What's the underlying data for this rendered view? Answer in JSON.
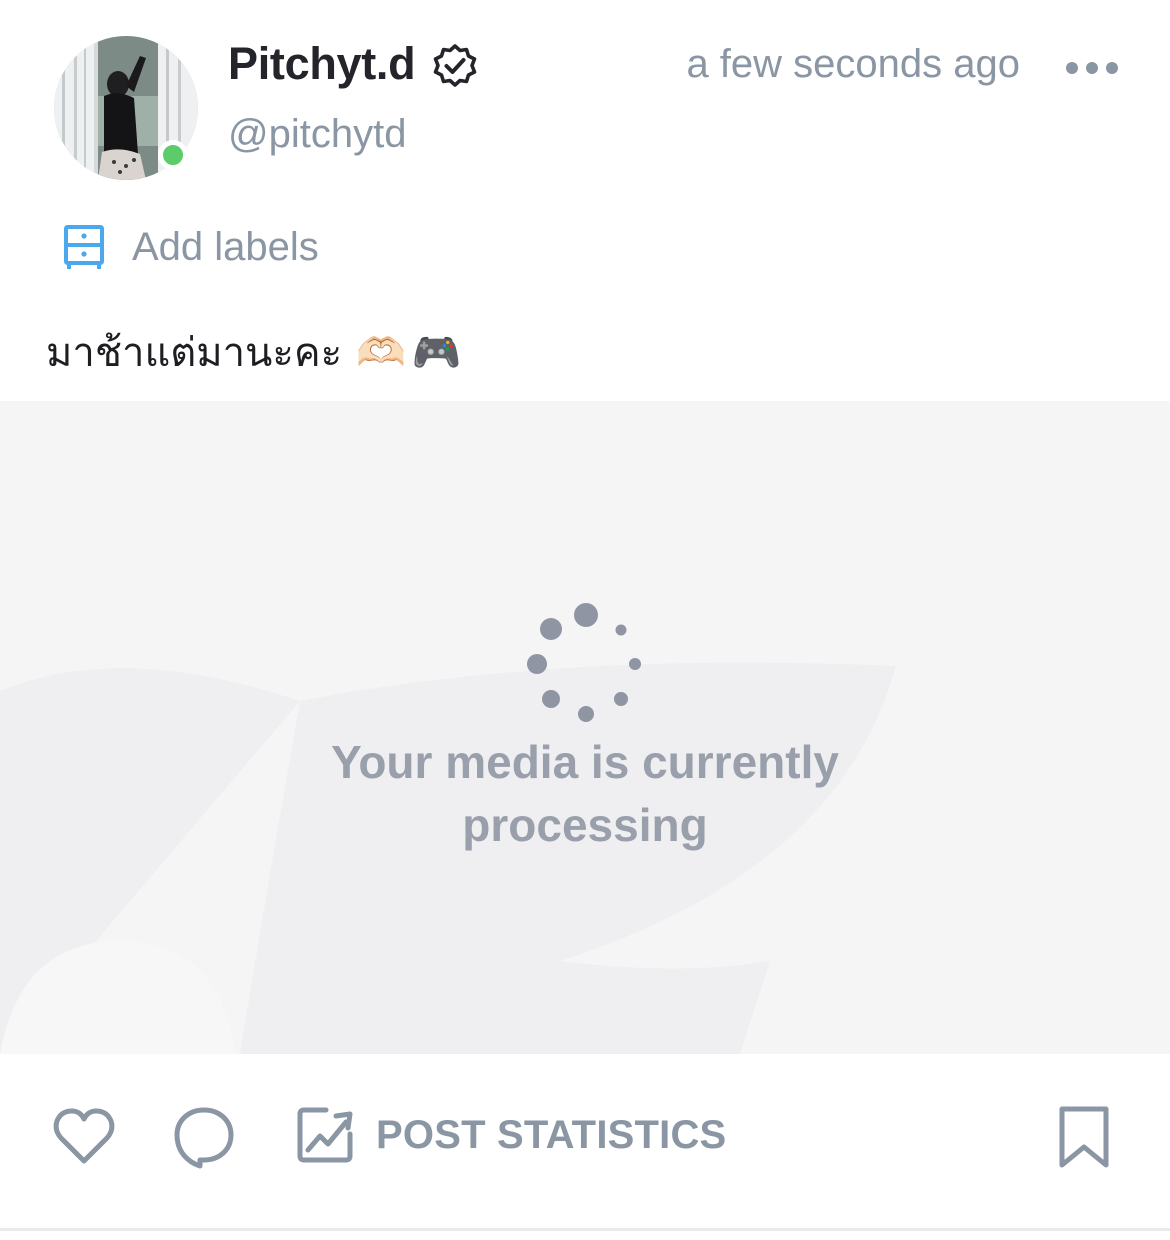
{
  "post": {
    "author": {
      "display_name": "Pitchyt.d",
      "username": "@pitchytd",
      "verified": true,
      "online": true,
      "online_color": "#5ccc6a"
    },
    "timestamp": "a few seconds ago",
    "labels_action": "Add labels",
    "caption": {
      "text": "มาช้าแต่มานะคะ",
      "emojis": [
        "🫶🏻",
        "🎮"
      ]
    },
    "media": {
      "status_text": "Your media is currently processing"
    },
    "actions": {
      "statistics_label": "POST STATISTICS"
    }
  },
  "icons": {
    "more": "more-icon",
    "verified": "verified-badge-icon",
    "labels": "labels-drawer-icon",
    "like": "heart-icon",
    "comment": "comment-bubble-icon",
    "statistics": "chart-trend-icon",
    "bookmark": "bookmark-icon"
  },
  "colors": {
    "accent": "#00aff0",
    "muted_text": "#8a96a3",
    "primary_text": "#24252a",
    "media_placeholder": "#f5f5f6"
  }
}
